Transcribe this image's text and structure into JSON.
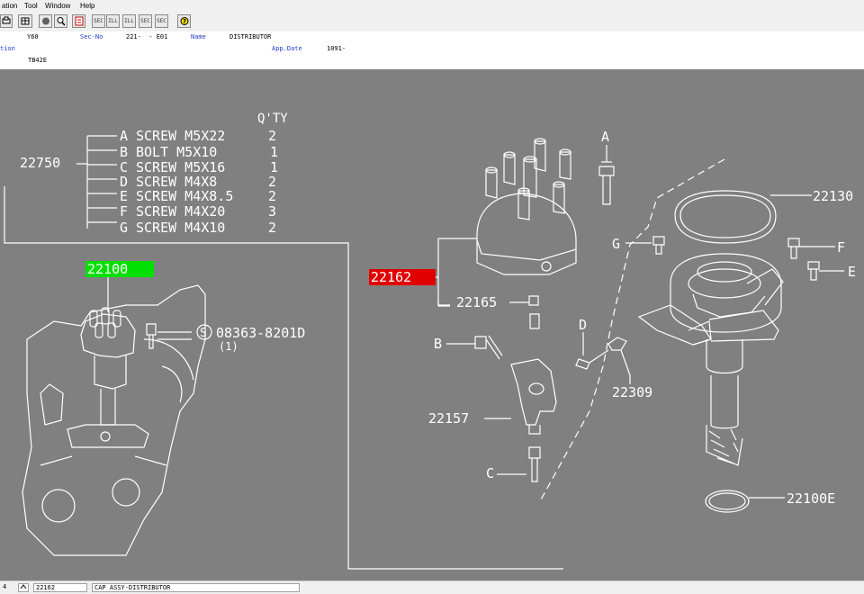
{
  "menu": {
    "items": [
      "ation",
      "Tool",
      "Window",
      "Help"
    ]
  },
  "toolbar": {
    "buttons": [
      {
        "name": "print-icon"
      },
      {
        "name": "grid-icon"
      },
      {
        "name": "record-icon"
      },
      {
        "name": "zoom-icon"
      },
      {
        "name": "page-icon"
      },
      {
        "label": "SEC",
        "name": "sec-button-1"
      },
      {
        "label": "ILL",
        "name": "ill-button-1"
      },
      {
        "label": "ILL",
        "name": "ill-button-2"
      },
      {
        "label": "SEC",
        "name": "sec-button-2"
      },
      {
        "label": "SEC",
        "name": "sec-button-3"
      },
      {
        "name": "help-icon"
      }
    ]
  },
  "info": {
    "model_value": "Y60",
    "secno_label": "Sec-No",
    "secno_value": "221-  - E01",
    "name_label": "Name",
    "name_value": "DISTRIBUTOR",
    "row2_label": "tion",
    "appdate_label": "App.Date",
    "appdate_value": "1091-",
    "engine_value": "TB42E"
  },
  "diagram": {
    "qty_header": "Q'TY",
    "kit_number": "22750",
    "kit_items": [
      {
        "letter": "A",
        "desc": "SCREW M5X22",
        "qty": "2"
      },
      {
        "letter": "B",
        "desc": "BOLT M5X10",
        "qty": "1"
      },
      {
        "letter": "C",
        "desc": "SCREW M5X16",
        "qty": "1"
      },
      {
        "letter": "D",
        "desc": "SCREW M4X8",
        "qty": "2"
      },
      {
        "letter": "E",
        "desc": "SCREW M4X8.5",
        "qty": "2"
      },
      {
        "letter": "F",
        "desc": "SCREW M4X20",
        "qty": "3"
      },
      {
        "letter": "G",
        "desc": "SCREW M4X10",
        "qty": "2"
      }
    ],
    "part_22100": "22100",
    "part_22162": "22162",
    "part_22165": "22165",
    "part_22157": "22157",
    "part_22309": "22309",
    "part_22130": "22130",
    "part_22100E": "22100E",
    "part_08363": "08363-8201D",
    "part_08363_qty": "(1)",
    "s_mark": "S",
    "callouts": {
      "a": "A",
      "b": "B",
      "c": "C",
      "d": "D",
      "e": "E",
      "f": "F",
      "g": "G"
    },
    "colors": {
      "highlight_green": "#00e000",
      "highlight_red": "#e00000",
      "line": "#ffffff",
      "background": "#808080"
    }
  },
  "status": {
    "page": "4",
    "part_no": "22162",
    "part_name": "CAP ASSY-DISTRIBUTOR"
  }
}
